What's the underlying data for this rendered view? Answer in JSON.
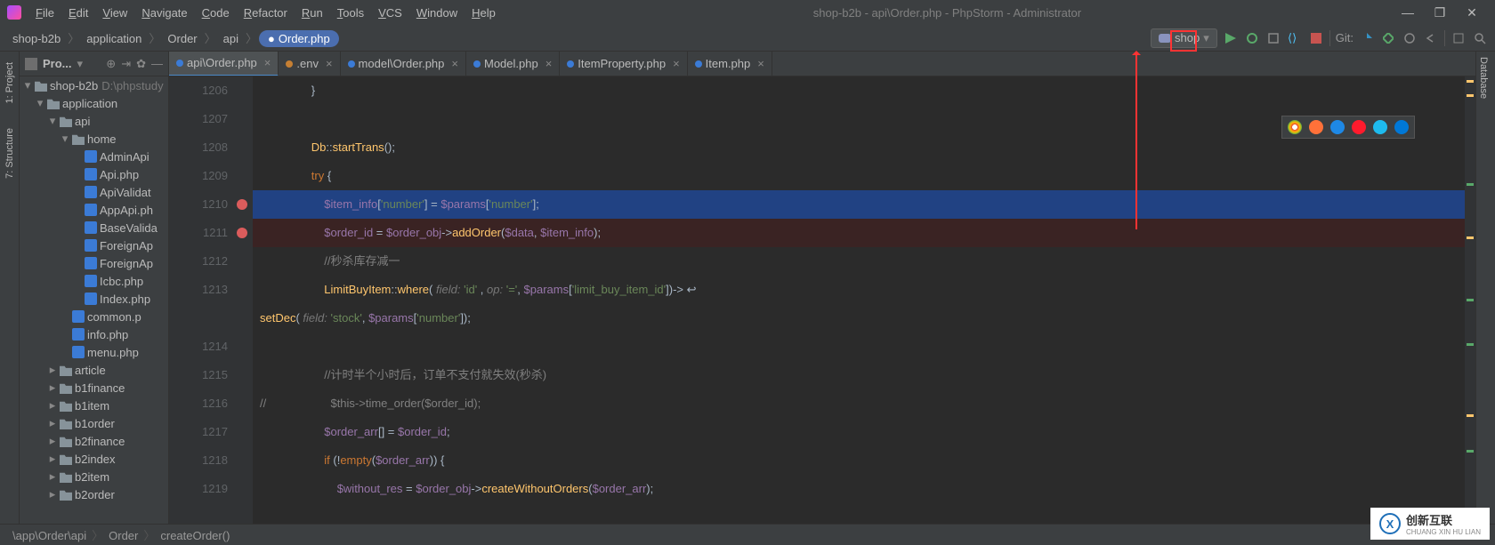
{
  "window": {
    "title": "shop-b2b - api\\Order.php - PhpStorm - Administrator",
    "menu": [
      "File",
      "Edit",
      "View",
      "Navigate",
      "Code",
      "Refactor",
      "Run",
      "Tools",
      "VCS",
      "Window",
      "Help"
    ]
  },
  "breadcrumb": [
    "shop-b2b",
    "application",
    "Order",
    "api",
    "Order.php"
  ],
  "run_config": {
    "label": "shop"
  },
  "toolbar_right": {
    "git_label": "Git:"
  },
  "left_tabs": [
    "1: Project",
    "7: Structure"
  ],
  "right_tabs": [
    "Database"
  ],
  "project": {
    "header": "Pro...",
    "root": {
      "name": "shop-b2b",
      "path": "D:\\phpstudy"
    },
    "nodes": [
      {
        "depth": 0,
        "type": "folder",
        "open": true,
        "name": "shop-b2b",
        "path": "D:\\phpstudy"
      },
      {
        "depth": 1,
        "type": "folder",
        "open": true,
        "name": "application"
      },
      {
        "depth": 2,
        "type": "folder",
        "open": true,
        "name": "api"
      },
      {
        "depth": 3,
        "type": "folder",
        "open": true,
        "name": "home"
      },
      {
        "depth": 4,
        "type": "php",
        "name": "AdminApi"
      },
      {
        "depth": 4,
        "type": "php",
        "name": "Api.php"
      },
      {
        "depth": 4,
        "type": "php",
        "name": "ApiValidat"
      },
      {
        "depth": 4,
        "type": "php",
        "name": "AppApi.ph"
      },
      {
        "depth": 4,
        "type": "php",
        "name": "BaseValida"
      },
      {
        "depth": 4,
        "type": "php",
        "name": "ForeignAp"
      },
      {
        "depth": 4,
        "type": "php",
        "name": "ForeignAp"
      },
      {
        "depth": 4,
        "type": "php",
        "name": "Icbc.php"
      },
      {
        "depth": 4,
        "type": "php",
        "name": "Index.php"
      },
      {
        "depth": 3,
        "type": "php",
        "name": "common.p"
      },
      {
        "depth": 3,
        "type": "php",
        "name": "info.php"
      },
      {
        "depth": 3,
        "type": "php",
        "name": "menu.php"
      },
      {
        "depth": 2,
        "type": "folder",
        "open": false,
        "name": "article"
      },
      {
        "depth": 2,
        "type": "folder",
        "open": false,
        "name": "b1finance"
      },
      {
        "depth": 2,
        "type": "folder",
        "open": false,
        "name": "b1item"
      },
      {
        "depth": 2,
        "type": "folder",
        "open": false,
        "name": "b1order"
      },
      {
        "depth": 2,
        "type": "folder",
        "open": false,
        "name": "b2finance"
      },
      {
        "depth": 2,
        "type": "folder",
        "open": false,
        "name": "b2index"
      },
      {
        "depth": 2,
        "type": "folder",
        "open": false,
        "name": "b2item"
      },
      {
        "depth": 2,
        "type": "folder",
        "open": false,
        "name": "b2order"
      }
    ]
  },
  "tabs": [
    {
      "label": "api\\Order.php",
      "color": "#3b7bd6",
      "active": true
    },
    {
      "label": ".env",
      "color": "#c57f33",
      "active": false
    },
    {
      "label": "model\\Order.php",
      "color": "#3b7bd6",
      "active": false
    },
    {
      "label": "Model.php",
      "color": "#3b7bd6",
      "active": false
    },
    {
      "label": "ItemProperty.php",
      "color": "#3b7bd6",
      "active": false
    },
    {
      "label": "Item.php",
      "color": "#3b7bd6",
      "active": false
    }
  ],
  "code": {
    "first_line": 1206,
    "lines": [
      {
        "n": 1206,
        "html": "                }"
      },
      {
        "n": 1207,
        "html": ""
      },
      {
        "n": 1208,
        "html": "                <span class='fn'>Db</span><span class='op'>::</span><span class='fn'>startTrans</span>();"
      },
      {
        "n": 1209,
        "html": "                <span class='kw'>try</span> {"
      },
      {
        "n": 1210,
        "bp": true,
        "cls": "hl1",
        "html": "                    <span class='var'>$item_info</span>[<span class='str'>'number'</span>] = <span class='var'>$params</span>[<span class='str'>'number'</span>];"
      },
      {
        "n": 1211,
        "bp": true,
        "cls": "hl2",
        "html": "                    <span class='var'>$order_id</span> = <span class='var'>$order_obj</span>-&gt;<span class='fn'>addOrder</span>(<span class='var'>$data</span>, <span class='var'>$item_info</span>);"
      },
      {
        "n": 1212,
        "html": "                    <span class='cm'>//秒杀库存减一</span>"
      },
      {
        "n": 1213,
        "wrap": true,
        "html": "                    <span class='fn'>LimitBuyItem</span><span class='op'>::</span><span class='fn'>where</span>( <span class='hint'>field:</span> <span class='str'>'id'</span> , <span class='hint'>op:</span> <span class='str'>'='</span>, <span class='var'>$params</span>[<span class='str'>'limit_buy_item_id'</span>])-&gt; ↩"
      },
      {
        "n": 0,
        "cont": true,
        "html": "<span class='fn'>setDec</span>( <span class='hint'>field:</span> <span class='str'>'stock'</span>, <span class='var'>$params</span>[<span class='str'>'number'</span>]);"
      },
      {
        "n": 1214,
        "html": ""
      },
      {
        "n": 1215,
        "html": "                    <span class='cm'>//计时半个小时后，订单不支付就失效(秒杀)</span>"
      },
      {
        "n": 1216,
        "html": "<span class='cm'>//                    $this-&gt;time_order($order_id);</span>"
      },
      {
        "n": 1217,
        "html": "                    <span class='var'>$order_arr</span>[] = <span class='var'>$order_id</span>;"
      },
      {
        "n": 1218,
        "html": "                    <span class='kw'>if</span> (!<span class='kw'>empty</span>(<span class='var'>$order_arr</span>)) {"
      },
      {
        "n": 1219,
        "html": "                        <span class='var'>$without_res</span> = <span class='var'>$order_obj</span>-&gt;<span class='fn'>createWithoutOrders</span>(<span class='var'>$order_arr</span>);"
      }
    ]
  },
  "status": {
    "path": [
      "\\app\\Order\\api",
      "Order",
      "createOrder()"
    ]
  },
  "browsers": [
    "chrome",
    "firefox",
    "safari",
    "opera",
    "ie",
    "edge"
  ],
  "watermark": {
    "brand": "创新互联",
    "sub": "CHUANG XIN HU LIAN",
    "logoLetter": "X"
  }
}
